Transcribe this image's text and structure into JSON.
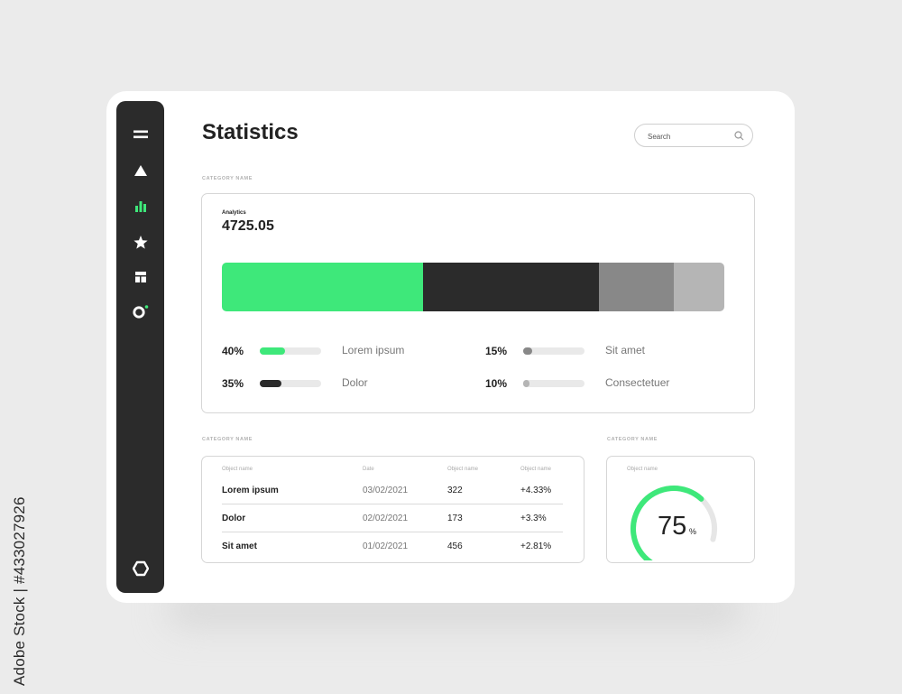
{
  "colors": {
    "accent": "#3ee87a",
    "dark": "#2b2b2b",
    "gray": "#888888",
    "light_gray": "#b5b5b5"
  },
  "watermark_side": "Adobe Stock | #433027926",
  "sidebar": {
    "items": [
      {
        "icon": "menu-icon"
      },
      {
        "icon": "triangle-icon"
      },
      {
        "icon": "bar-chart-icon",
        "active": true
      },
      {
        "icon": "star-icon"
      },
      {
        "icon": "dashboard-icon"
      },
      {
        "icon": "ring-icon",
        "badge": true
      }
    ],
    "bottom_icon": "hexagon-icon"
  },
  "header": {
    "title": "Statistics"
  },
  "search": {
    "placeholder": "Search",
    "icon": "search-icon"
  },
  "sections": {
    "top_category": "CATEGORY NAME",
    "table_category": "CATEGORY NAME",
    "gauge_category": "CATEGORY NAME"
  },
  "analytics": {
    "label": "Analytics",
    "value": "4725.05",
    "segments": [
      {
        "name": "Lorem ipsum",
        "pct_label": "40%",
        "fraction": 0.4,
        "color": "#3ee87a"
      },
      {
        "name": "Dolor",
        "pct_label": "35%",
        "fraction": 0.35,
        "color": "#2b2b2b"
      },
      {
        "name": "Sit amet",
        "pct_label": "15%",
        "fraction": 0.15,
        "color": "#888888"
      },
      {
        "name": "Consectetuer",
        "pct_label": "10%",
        "fraction": 0.1,
        "color": "#b5b5b5"
      }
    ]
  },
  "table": {
    "headers": [
      "Object name",
      "Date",
      "Object name",
      "Object name"
    ],
    "rows": [
      [
        "Lorem ipsum",
        "03/02/2021",
        "322",
        "+4.33%"
      ],
      [
        "Dolor",
        "02/02/2021",
        "173",
        "+3.3%"
      ],
      [
        "Sit amet",
        "01/02/2021",
        "456",
        "+2.81%"
      ]
    ]
  },
  "gauge": {
    "label": "Object name",
    "value": "75",
    "unit": "%",
    "fraction": 0.75
  }
}
